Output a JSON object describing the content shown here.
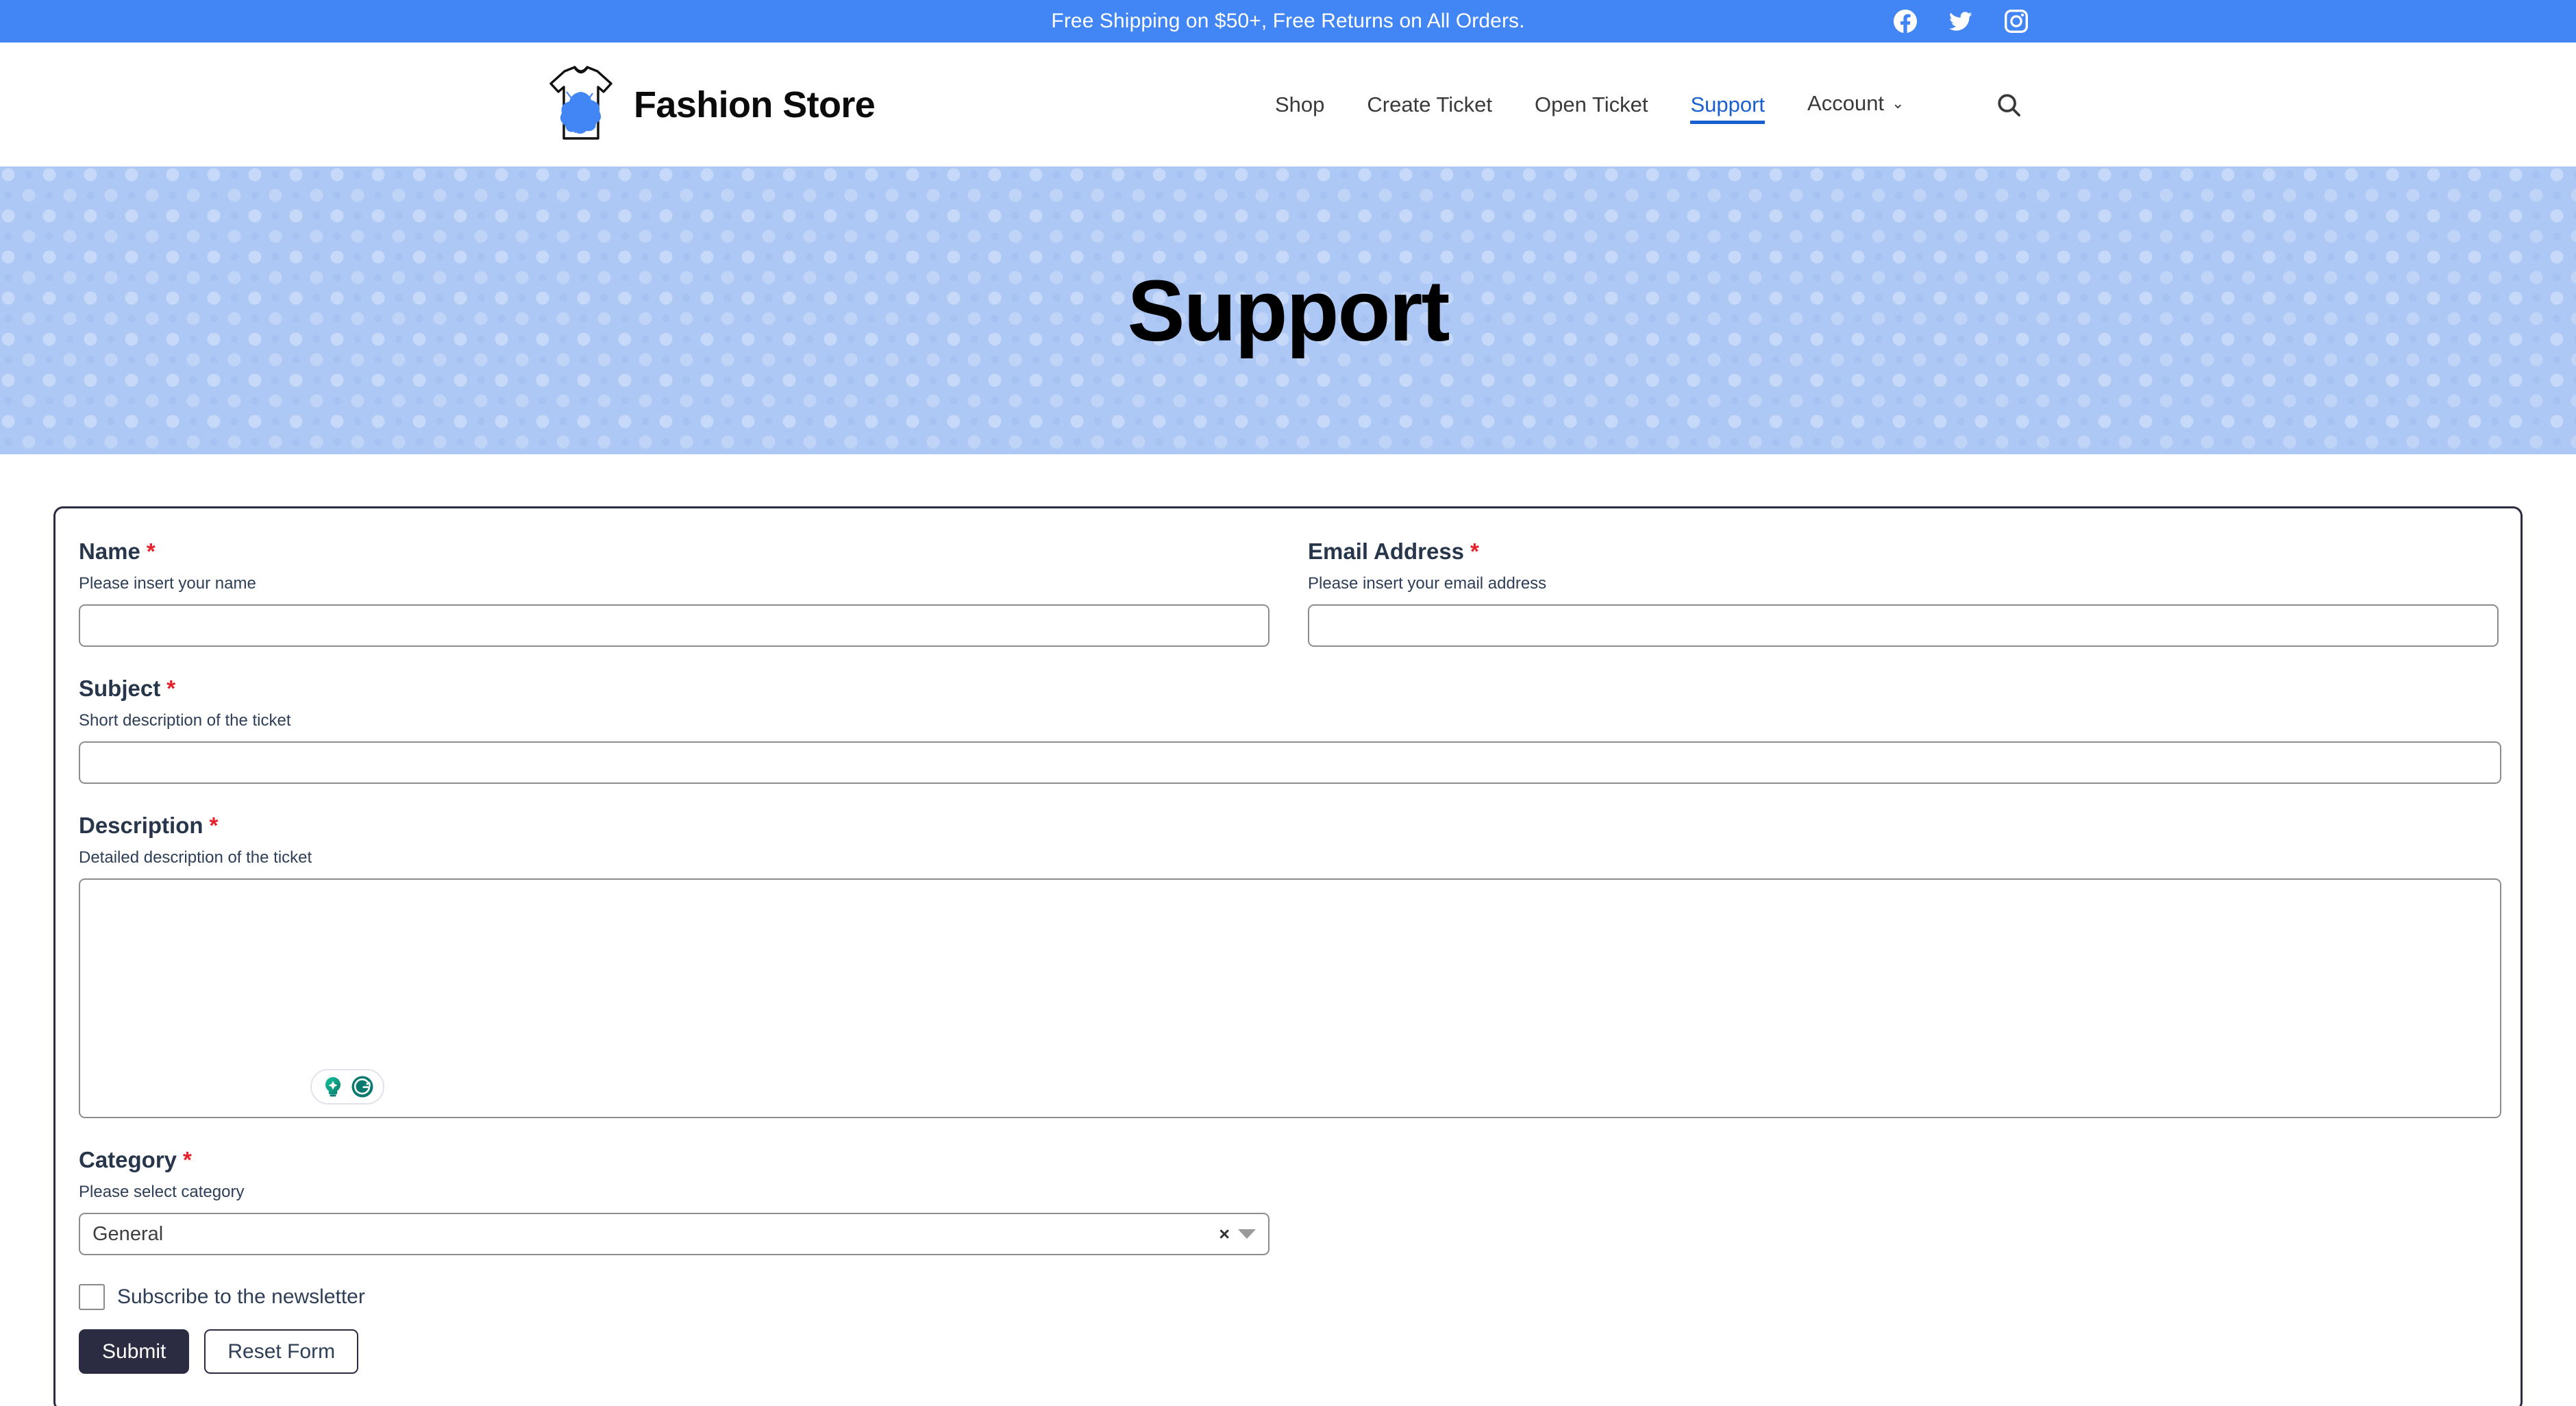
{
  "announcement": {
    "text": "Free Shipping on $50+, Free Returns on All Orders.",
    "social": [
      {
        "name": "facebook-icon",
        "label": "Facebook"
      },
      {
        "name": "twitter-icon",
        "label": "Twitter"
      },
      {
        "name": "instagram-icon",
        "label": "Instagram"
      }
    ],
    "bg_color": "#4285f4"
  },
  "header": {
    "brand_name": "Fashion Store",
    "logo_icon": "tshirt-splatter-logo",
    "nav": [
      {
        "label": "Shop",
        "active": false,
        "has_caret": false
      },
      {
        "label": "Create Ticket",
        "active": false,
        "has_caret": false
      },
      {
        "label": "Open Ticket",
        "active": false,
        "has_caret": false
      },
      {
        "label": "Support",
        "active": true,
        "has_caret": false
      },
      {
        "label": "Account",
        "active": false,
        "has_caret": true
      }
    ],
    "caret_glyph": "⌄",
    "search_icon": "search-icon",
    "active_color": "#1a5fd0"
  },
  "hero": {
    "title": "Support",
    "bg_color": "#adc8f5"
  },
  "form": {
    "required_marker": "*",
    "name": {
      "label": "Name",
      "help": "Please insert your name",
      "value": "",
      "placeholder": ""
    },
    "email": {
      "label": "Email Address",
      "help": "Please insert your email address",
      "value": "",
      "placeholder": ""
    },
    "subject": {
      "label": "Subject",
      "help": "Short description of the ticket",
      "value": "",
      "placeholder": ""
    },
    "description": {
      "label": "Description",
      "help": "Detailed description of the ticket",
      "value": "",
      "placeholder": ""
    },
    "category": {
      "label": "Category",
      "help": "Please select category",
      "selected": "General",
      "clear_glyph": "×",
      "options": [
        "General"
      ]
    },
    "newsletter": {
      "label": "Subscribe to the newsletter",
      "checked": false
    },
    "submit_label": "Submit",
    "reset_label": "Reset Form",
    "assistant_widget": {
      "name": "grammarly-widget",
      "icons": [
        "lightbulb-icon",
        "grammarly-g-icon"
      ],
      "color": "#0b7a6b"
    }
  }
}
